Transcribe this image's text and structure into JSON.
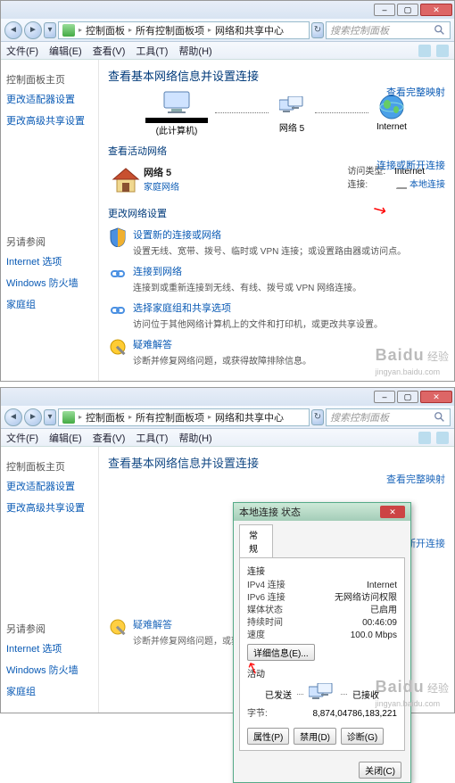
{
  "titlebar": {
    "min": "–",
    "max": "▢",
    "close": "✕"
  },
  "nav": {
    "back": "◄",
    "fwd": "►",
    "crumbs": [
      "控制面板",
      "所有控制面板项",
      "网络和共享中心"
    ]
  },
  "search": {
    "placeholder": "搜索控制面板"
  },
  "menu": [
    "文件(F)",
    "编辑(E)",
    "查看(V)",
    "工具(T)",
    "帮助(H)"
  ],
  "sidebar": {
    "home": "控制面板主页",
    "links": [
      "更改适配器设置",
      "更改高级共享设置"
    ],
    "also_hdr": "另请参阅",
    "also": [
      "Internet 选项",
      "Windows 防火墙",
      "家庭组"
    ]
  },
  "main": {
    "h1": "查看基本网络信息并设置连接",
    "map_link": "查看完整映射",
    "nodes": {
      "pc": "(此计算机)",
      "net": "网络 5",
      "internet": "Internet"
    },
    "active_hdr": "查看活动网络",
    "conn_link": "连接或断开连接",
    "net": {
      "name": "网络 5",
      "type": "家庭网络",
      "access_lbl": "访问类型:",
      "access_val": "Internet",
      "conn_lbl": "连接:",
      "conn_val": "本地连接"
    },
    "change_hdr": "更改网络设置",
    "items": [
      {
        "t": "设置新的连接或网络",
        "d": "设置无线、宽带、拨号、临时或 VPN 连接；或设置路由器或访问点。"
      },
      {
        "t": "连接到网络",
        "d": "连接到或重新连接到无线、有线、拨号或 VPN 网络连接。"
      },
      {
        "t": "选择家庭组和共享选项",
        "d": "访问位于其他网络计算机上的文件和打印机，或更改共享设置。"
      },
      {
        "t": "疑难解答",
        "d": "诊断并修复网络问题，或获得故障排除信息。"
      }
    ]
  },
  "dialog": {
    "title": "本地连接 状态",
    "tab": "常规",
    "sect_conn": "连接",
    "kv": [
      {
        "k": "IPv4 连接",
        "v": "Internet"
      },
      {
        "k": "IPv6 连接",
        "v": "无网络访问权限"
      },
      {
        "k": "媒体状态",
        "v": "已启用"
      },
      {
        "k": "持续时间",
        "v": "00:46:09"
      },
      {
        "k": "速度",
        "v": "100.0 Mbps"
      }
    ],
    "detail_btn": "详细信息(E)...",
    "sect_act": "活动",
    "sent_lbl": "已发送",
    "recv_lbl": "已接收",
    "bytes_lbl": "字节:",
    "sent_val": "8,874,047",
    "recv_val": "86,183,221",
    "prop_btn": "属性(P)",
    "disable_btn": "禁用(D)",
    "diag_btn": "诊断(G)",
    "close_btn": "关闭(C)"
  },
  "watermark": {
    "brand": "Baidu",
    "sub": "经验",
    "url": "jingyan.baidu.com"
  }
}
